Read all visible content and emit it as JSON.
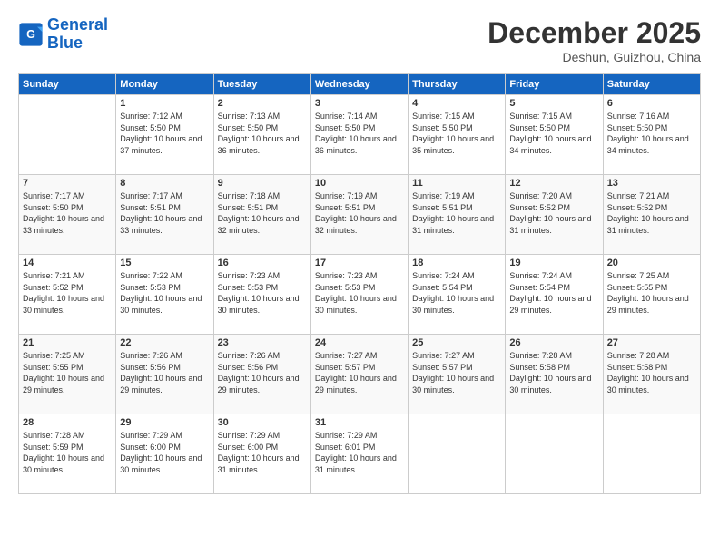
{
  "header": {
    "logo_line1": "General",
    "logo_line2": "Blue",
    "month": "December 2025",
    "location": "Deshun, Guizhou, China"
  },
  "days_of_week": [
    "Sunday",
    "Monday",
    "Tuesday",
    "Wednesday",
    "Thursday",
    "Friday",
    "Saturday"
  ],
  "weeks": [
    [
      {
        "day": "",
        "sunrise": "",
        "sunset": "",
        "daylight": ""
      },
      {
        "day": "1",
        "sunrise": "7:12 AM",
        "sunset": "5:50 PM",
        "daylight": "10 hours and 37 minutes."
      },
      {
        "day": "2",
        "sunrise": "7:13 AM",
        "sunset": "5:50 PM",
        "daylight": "10 hours and 36 minutes."
      },
      {
        "day": "3",
        "sunrise": "7:14 AM",
        "sunset": "5:50 PM",
        "daylight": "10 hours and 36 minutes."
      },
      {
        "day": "4",
        "sunrise": "7:15 AM",
        "sunset": "5:50 PM",
        "daylight": "10 hours and 35 minutes."
      },
      {
        "day": "5",
        "sunrise": "7:15 AM",
        "sunset": "5:50 PM",
        "daylight": "10 hours and 34 minutes."
      },
      {
        "day": "6",
        "sunrise": "7:16 AM",
        "sunset": "5:50 PM",
        "daylight": "10 hours and 34 minutes."
      }
    ],
    [
      {
        "day": "7",
        "sunrise": "7:17 AM",
        "sunset": "5:50 PM",
        "daylight": "10 hours and 33 minutes."
      },
      {
        "day": "8",
        "sunrise": "7:17 AM",
        "sunset": "5:51 PM",
        "daylight": "10 hours and 33 minutes."
      },
      {
        "day": "9",
        "sunrise": "7:18 AM",
        "sunset": "5:51 PM",
        "daylight": "10 hours and 32 minutes."
      },
      {
        "day": "10",
        "sunrise": "7:19 AM",
        "sunset": "5:51 PM",
        "daylight": "10 hours and 32 minutes."
      },
      {
        "day": "11",
        "sunrise": "7:19 AM",
        "sunset": "5:51 PM",
        "daylight": "10 hours and 31 minutes."
      },
      {
        "day": "12",
        "sunrise": "7:20 AM",
        "sunset": "5:52 PM",
        "daylight": "10 hours and 31 minutes."
      },
      {
        "day": "13",
        "sunrise": "7:21 AM",
        "sunset": "5:52 PM",
        "daylight": "10 hours and 31 minutes."
      }
    ],
    [
      {
        "day": "14",
        "sunrise": "7:21 AM",
        "sunset": "5:52 PM",
        "daylight": "10 hours and 30 minutes."
      },
      {
        "day": "15",
        "sunrise": "7:22 AM",
        "sunset": "5:53 PM",
        "daylight": "10 hours and 30 minutes."
      },
      {
        "day": "16",
        "sunrise": "7:23 AM",
        "sunset": "5:53 PM",
        "daylight": "10 hours and 30 minutes."
      },
      {
        "day": "17",
        "sunrise": "7:23 AM",
        "sunset": "5:53 PM",
        "daylight": "10 hours and 30 minutes."
      },
      {
        "day": "18",
        "sunrise": "7:24 AM",
        "sunset": "5:54 PM",
        "daylight": "10 hours and 30 minutes."
      },
      {
        "day": "19",
        "sunrise": "7:24 AM",
        "sunset": "5:54 PM",
        "daylight": "10 hours and 29 minutes."
      },
      {
        "day": "20",
        "sunrise": "7:25 AM",
        "sunset": "5:55 PM",
        "daylight": "10 hours and 29 minutes."
      }
    ],
    [
      {
        "day": "21",
        "sunrise": "7:25 AM",
        "sunset": "5:55 PM",
        "daylight": "10 hours and 29 minutes."
      },
      {
        "day": "22",
        "sunrise": "7:26 AM",
        "sunset": "5:56 PM",
        "daylight": "10 hours and 29 minutes."
      },
      {
        "day": "23",
        "sunrise": "7:26 AM",
        "sunset": "5:56 PM",
        "daylight": "10 hours and 29 minutes."
      },
      {
        "day": "24",
        "sunrise": "7:27 AM",
        "sunset": "5:57 PM",
        "daylight": "10 hours and 29 minutes."
      },
      {
        "day": "25",
        "sunrise": "7:27 AM",
        "sunset": "5:57 PM",
        "daylight": "10 hours and 30 minutes."
      },
      {
        "day": "26",
        "sunrise": "7:28 AM",
        "sunset": "5:58 PM",
        "daylight": "10 hours and 30 minutes."
      },
      {
        "day": "27",
        "sunrise": "7:28 AM",
        "sunset": "5:58 PM",
        "daylight": "10 hours and 30 minutes."
      }
    ],
    [
      {
        "day": "28",
        "sunrise": "7:28 AM",
        "sunset": "5:59 PM",
        "daylight": "10 hours and 30 minutes."
      },
      {
        "day": "29",
        "sunrise": "7:29 AM",
        "sunset": "6:00 PM",
        "daylight": "10 hours and 30 minutes."
      },
      {
        "day": "30",
        "sunrise": "7:29 AM",
        "sunset": "6:00 PM",
        "daylight": "10 hours and 31 minutes."
      },
      {
        "day": "31",
        "sunrise": "7:29 AM",
        "sunset": "6:01 PM",
        "daylight": "10 hours and 31 minutes."
      },
      {
        "day": "",
        "sunrise": "",
        "sunset": "",
        "daylight": ""
      },
      {
        "day": "",
        "sunrise": "",
        "sunset": "",
        "daylight": ""
      },
      {
        "day": "",
        "sunrise": "",
        "sunset": "",
        "daylight": ""
      }
    ]
  ]
}
